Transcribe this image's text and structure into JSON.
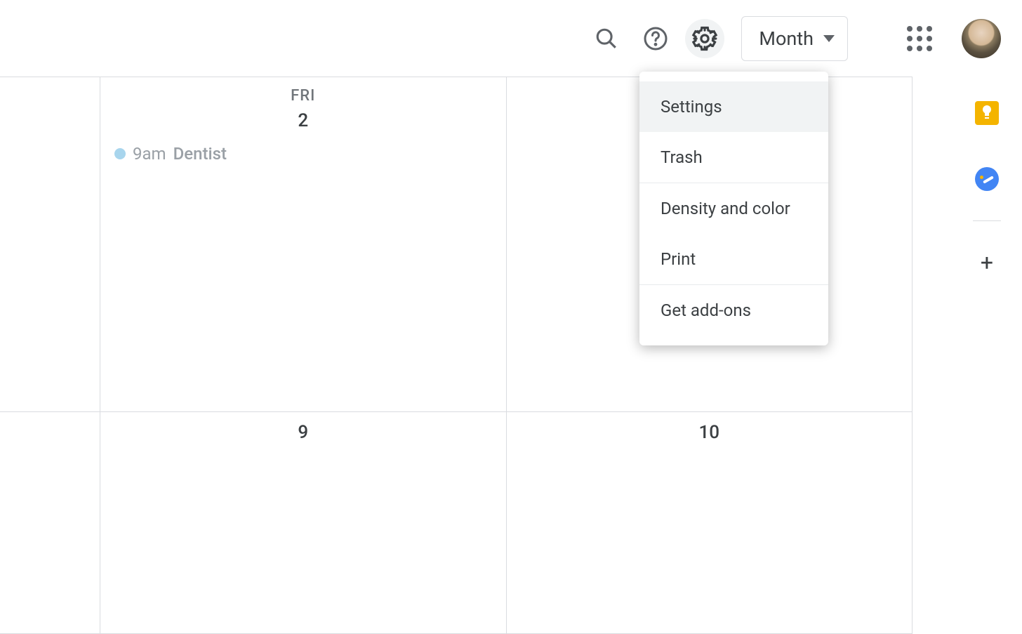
{
  "header": {
    "view_label": "Month",
    "icons": {
      "search": "search-icon",
      "help": "help-icon",
      "settings": "gear-icon",
      "apps": "apps-icon"
    }
  },
  "calendar": {
    "row1": {
      "col1_day_label": "FRI",
      "col1_day_num": "2",
      "col2_day_num": ""
    },
    "row2": {
      "col1_day_num": "9",
      "col2_day_num": "10"
    },
    "event": {
      "time": "9am",
      "title": "Dentist",
      "color": "#a8d5ed"
    }
  },
  "settings_menu": {
    "items": [
      {
        "label": "Settings",
        "highlighted": true
      },
      {
        "label": "Trash",
        "highlighted": false
      },
      {
        "label": "Density and color",
        "highlighted": false
      },
      {
        "label": "Print",
        "highlighted": false
      },
      {
        "label": "Get add-ons",
        "highlighted": false
      }
    ]
  }
}
